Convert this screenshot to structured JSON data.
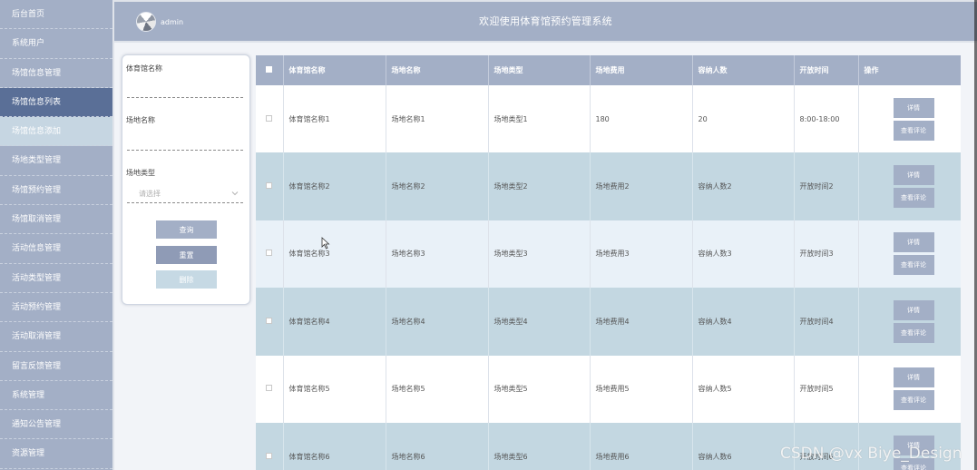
{
  "sidebar": {
    "items": [
      {
        "label": "后台首页"
      },
      {
        "label": "系统用户"
      },
      {
        "label": "场馆信息管理"
      },
      {
        "label": "场馆信息列表"
      },
      {
        "label": "场馆信息添加"
      },
      {
        "label": "场地类型管理"
      },
      {
        "label": "场馆预约管理"
      },
      {
        "label": "场馆取消管理"
      },
      {
        "label": "活动信息管理"
      },
      {
        "label": "活动类型管理"
      },
      {
        "label": "活动预约管理"
      },
      {
        "label": "活动取消管理"
      },
      {
        "label": "留言反馈管理"
      },
      {
        "label": "系统管理"
      },
      {
        "label": "通知公告管理"
      },
      {
        "label": "资源管理"
      }
    ]
  },
  "header": {
    "username": "admin",
    "title": "欢迎使用体育馆预约管理系统"
  },
  "search": {
    "gym_name_label": "体育馆名称",
    "venue_name_label": "场地名称",
    "venue_type_label": "场地类型",
    "venue_type_placeholder": "请选择",
    "query_button": "查询",
    "reset_button": "重置",
    "delete_button": "删除"
  },
  "table": {
    "columns": [
      "体育馆名称",
      "场地名称",
      "场地类型",
      "场地费用",
      "容纳人数",
      "开放时间",
      "操作"
    ],
    "detail_button": "详情",
    "review_button": "查看评论",
    "rows": [
      {
        "gym": "体育馆名称1",
        "venue": "场地名称1",
        "type": "场地类型1",
        "fee": "180",
        "capacity": "20",
        "hours": "8:00-18:00"
      },
      {
        "gym": "体育馆名称2",
        "venue": "场地名称2",
        "type": "场地类型2",
        "fee": "场地费用2",
        "capacity": "容纳人数2",
        "hours": "开放时间2"
      },
      {
        "gym": "体育馆名称3",
        "venue": "场地名称3",
        "type": "场地类型3",
        "fee": "场地费用3",
        "capacity": "容纳人数3",
        "hours": "开放时间3"
      },
      {
        "gym": "体育馆名称4",
        "venue": "场地名称4",
        "type": "场地类型4",
        "fee": "场地费用4",
        "capacity": "容纳人数4",
        "hours": "开放时间4"
      },
      {
        "gym": "体育馆名称5",
        "venue": "场地名称5",
        "type": "场地类型5",
        "fee": "场地费用5",
        "capacity": "容纳人数5",
        "hours": "开放时间5"
      },
      {
        "gym": "体育馆名称6",
        "venue": "场地名称6",
        "type": "场地类型6",
        "fee": "场地费用6",
        "capacity": "容纳人数6",
        "hours": "开放时间6"
      }
    ]
  },
  "watermark": "CSDN @vx Biye_Design",
  "colors": {
    "primary": "#a3afc6",
    "active_nav": "#5a6f97",
    "row_alt": "#c3d7e1"
  }
}
